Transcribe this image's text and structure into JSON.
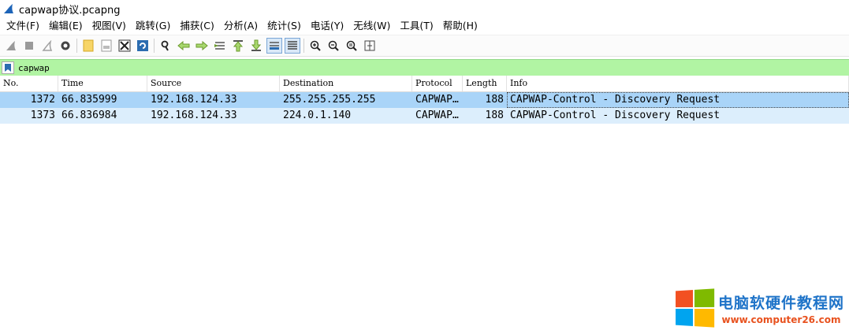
{
  "window": {
    "title": "capwap协议.pcapng"
  },
  "menu": [
    "文件(F)",
    "编辑(E)",
    "视图(V)",
    "跳转(G)",
    "捕获(C)",
    "分析(A)",
    "统计(S)",
    "电话(Y)",
    "无线(W)",
    "工具(T)",
    "帮助(H)"
  ],
  "filter": {
    "value": "capwap"
  },
  "columns": [
    "No.",
    "Time",
    "Source",
    "Destination",
    "Protocol",
    "Length",
    "Info"
  ],
  "packets": [
    {
      "no": "1372",
      "time": "66.835999",
      "source": "192.168.124.33",
      "destination": "255.255.255.255",
      "protocol": "CAPWAP…",
      "length": "188",
      "info": "CAPWAP-Control - Discovery Request"
    },
    {
      "no": "1373",
      "time": "66.836984",
      "source": "192.168.124.33",
      "destination": "224.0.1.140",
      "protocol": "CAPWAP…",
      "length": "188",
      "info": "CAPWAP-Control - Discovery Request"
    }
  ],
  "watermark": {
    "title": "电脑软硬件教程网",
    "url": "www.computer26.com"
  },
  "colors": {
    "filter_bg": "#b1f4a3",
    "selected_row": "#a9d4f8",
    "alt_row": "#dceefc",
    "watermark_title": "#1e73c8",
    "watermark_url": "#e8521f"
  }
}
